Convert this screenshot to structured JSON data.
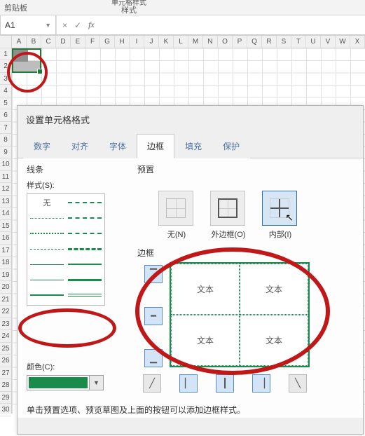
{
  "ribbon": {
    "clipboard_label": "剪贴板",
    "styles_title": "单元格样式",
    "styles_label": "样式"
  },
  "namebox": {
    "value": "A1"
  },
  "formula_bar": {
    "fx": "fx",
    "x": "×",
    "check": "✓"
  },
  "columns": [
    "A",
    "B",
    "C",
    "D",
    "E",
    "F",
    "G",
    "H",
    "I",
    "J",
    "K",
    "L",
    "M",
    "N",
    "O",
    "P",
    "Q",
    "R",
    "S",
    "T",
    "U",
    "V",
    "W",
    "X"
  ],
  "rows_max": 30,
  "dialog": {
    "title": "设置单元格格式",
    "tabs": [
      "数字",
      "对齐",
      "字体",
      "边框",
      "填充",
      "保护"
    ],
    "active_tab_index": 3,
    "line": {
      "section": "线条",
      "style_label": "样式(S):",
      "none_label": "无"
    },
    "color": {
      "label": "颜色(C):",
      "value": "#1a8b4a"
    },
    "preset": {
      "section": "预置",
      "none": "无(N)",
      "outline": "外边框(O)",
      "inside": "内部(I)"
    },
    "border": {
      "section": "边框",
      "sample": "文本"
    },
    "hint": "单击预置选项、预览草图及上面的按钮可以添加边框样式。"
  }
}
